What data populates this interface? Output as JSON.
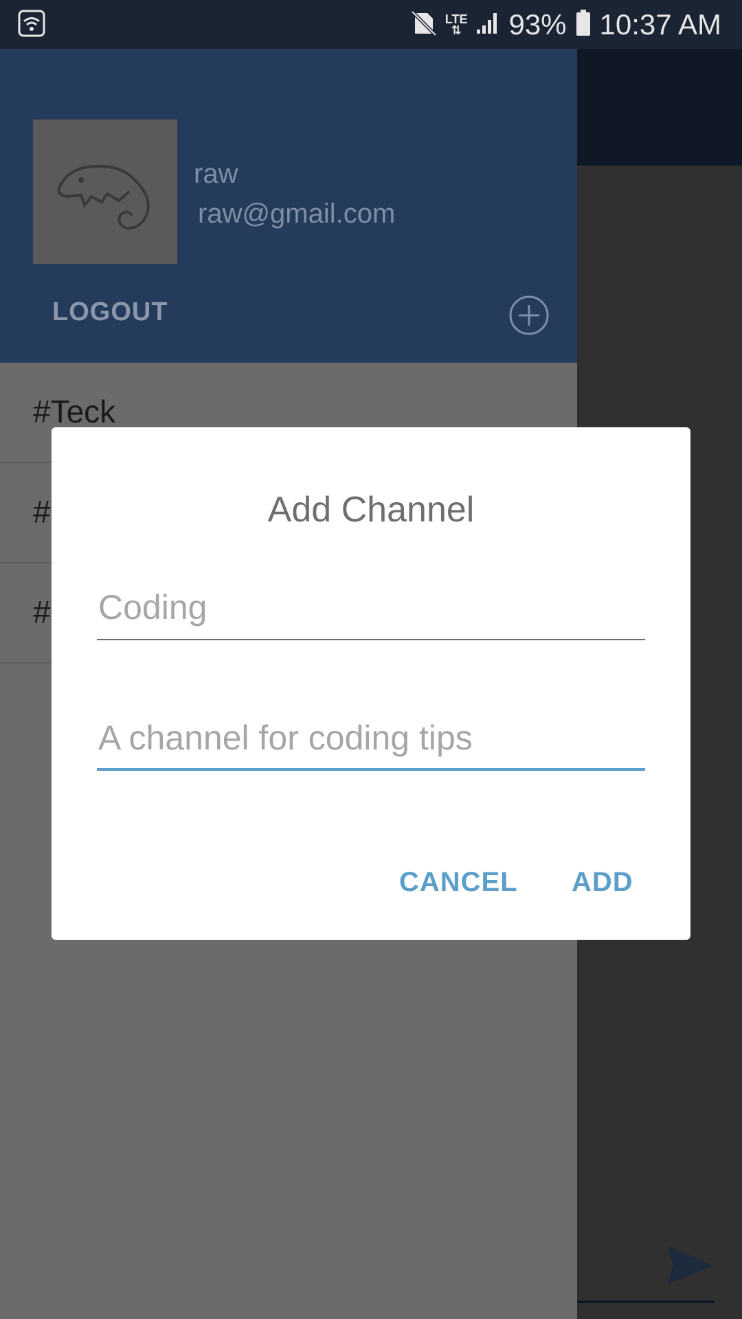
{
  "status_bar": {
    "battery": "93%",
    "time": "10:37 AM",
    "network": "LTE",
    "icons": [
      "wifi-icon",
      "no-sim-icon",
      "lte-icon",
      "signal-icon",
      "battery-icon"
    ]
  },
  "drawer": {
    "user": {
      "name": "raw",
      "email": "raw@gmail.com"
    },
    "logout_label": "LOGOUT",
    "add_icon": "plus-circle-icon",
    "channels": [
      "#Teck",
      "#",
      "#"
    ]
  },
  "dialog": {
    "title": "Add Channel",
    "name_placeholder": "Coding",
    "description_placeholder": "A channel for coding tips",
    "cancel_label": "CANCEL",
    "add_label": "ADD"
  },
  "colors": {
    "header": "#253b5b",
    "accent": "#5b9ec9",
    "status_bar": "#1a2433",
    "scrim": "#6b6b6b"
  }
}
